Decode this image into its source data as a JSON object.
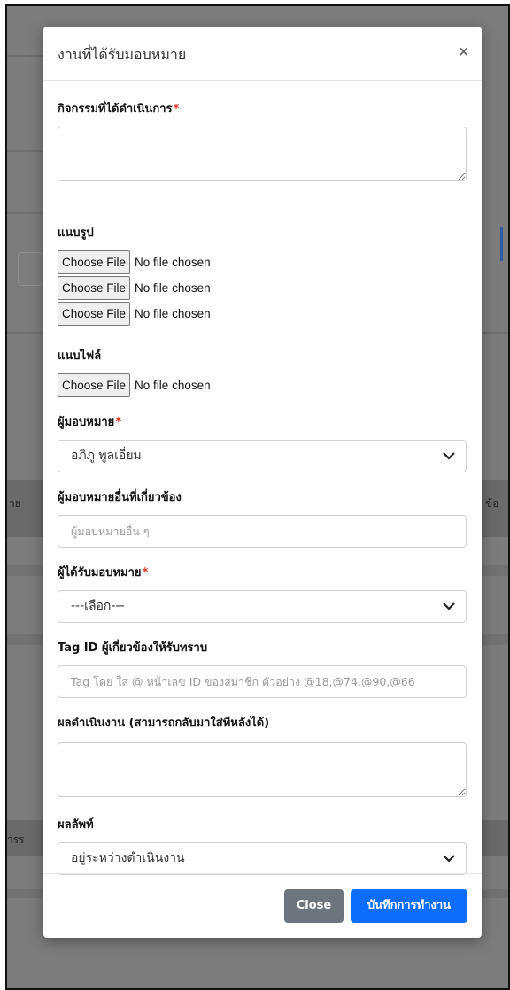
{
  "background": {
    "left_cut_texts": [
      "าย",
      "ารร"
    ],
    "right_cut_texts": [
      "ข้อ"
    ]
  },
  "modal": {
    "title": "งานที่ได้รับมอบหมาย",
    "close_symbol": "×",
    "fields": {
      "activity_label": "กิจกรรมที่ได้ดำเนินการ",
      "required_mark": "*",
      "images_label": "แนบรูป",
      "files_label": "แนบไฟล์",
      "choose_file": "Choose File",
      "no_file": "No file chosen",
      "assigner_label": "ผู้มอบหมาย",
      "assigner_value": "อภิภู พูลเอี่ยม",
      "other_assigner_label": "ผู้มอบหมายอื่นที่เกี่ยวข้อง",
      "other_assigner_placeholder": "ผู้มอบหมายอื่น ๆ",
      "assignee_label": "ผู้ได้รับมอบหมาย",
      "assignee_value": "---เลือก---",
      "tag_label": "Tag ID ผู้เกี่ยวข้องให้รับทราบ",
      "tag_placeholder": "Tag โดย ใส่ @ หน้าเลข ID ของสมาชิก ตัวอย่าง @18,@74,@90,@66",
      "result_label": "ผลดำเนินงาน (สามารถกลับมาใส่ทีหลังได้)",
      "outcome_label": "ผลลัพท์",
      "outcome_value": "อยู่ระหว่างดำเนินงาน"
    },
    "footer": {
      "close_label": "Close",
      "save_label": "บันทึกการทำงาน"
    }
  },
  "colors": {
    "primary": "#0d6efd",
    "secondary": "#6c757d",
    "required": "#e0342c",
    "overlay": "#7c7c7c"
  }
}
